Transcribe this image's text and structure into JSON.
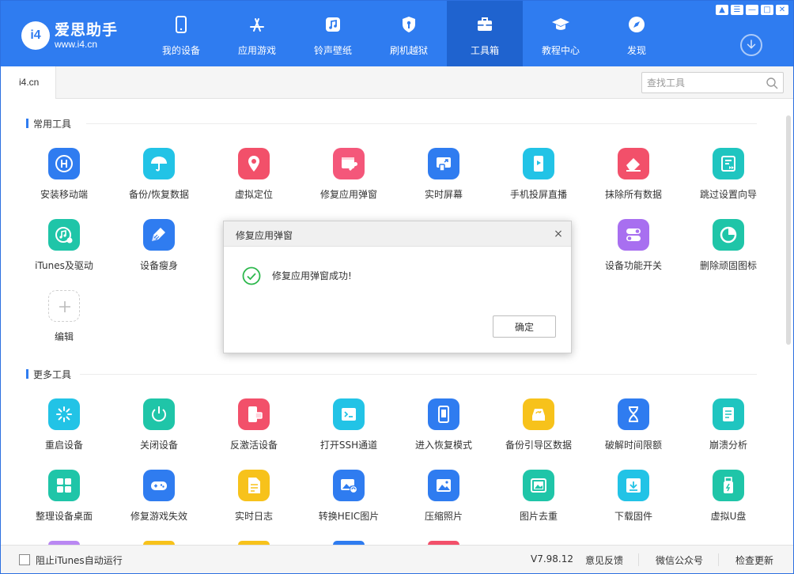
{
  "app": {
    "name": "爱思助手",
    "url": "www.i4.cn",
    "logo_mark": "i4"
  },
  "colors": {
    "header": "#2f7cf0",
    "header_active": "#1f63cf",
    "accent": "#2f7cf0"
  },
  "nav": [
    {
      "label": "我的设备",
      "icon": "phone-icon"
    },
    {
      "label": "应用游戏",
      "icon": "app-store-icon"
    },
    {
      "label": "铃声壁纸",
      "icon": "music-icon"
    },
    {
      "label": "刷机越狱",
      "icon": "shield-key-icon"
    },
    {
      "label": "工具箱",
      "icon": "toolbox-icon",
      "active": true
    },
    {
      "label": "教程中心",
      "icon": "graduation-cap-icon"
    },
    {
      "label": "发现",
      "icon": "compass-icon"
    }
  ],
  "window_controls": [
    "shirt-icon",
    "menu-icon",
    "minimize-icon",
    "maximize-icon",
    "close-icon"
  ],
  "tab": {
    "label": "i4.cn"
  },
  "search": {
    "placeholder": "查找工具",
    "value": ""
  },
  "sections": {
    "common": "常用工具",
    "more": "更多工具"
  },
  "common_tools": [
    {
      "label": "安装移动端",
      "color": "#2f7cf0",
      "icon": "i4-app-icon"
    },
    {
      "label": "备份/恢复数据",
      "color": "#22c3e6",
      "icon": "umbrella-icon"
    },
    {
      "label": "虚拟定位",
      "color": "#f2506a",
      "icon": "location-pin-icon"
    },
    {
      "label": "修复应用弹窗",
      "color": "#f4577a",
      "icon": "repair-window-icon"
    },
    {
      "label": "实时屏幕",
      "color": "#2f7cf0",
      "icon": "screen-share-icon"
    },
    {
      "label": "手机投屏直播",
      "color": "#22c3e6",
      "icon": "phone-play-icon"
    },
    {
      "label": "抹除所有数据",
      "color": "#f2506a",
      "icon": "eraser-icon"
    },
    {
      "label": "跳过设置向导",
      "color": "#1fc5c0",
      "icon": "skip-setup-icon"
    },
    {
      "label": "iTunes及驱动",
      "color": "#1fc5a8",
      "icon": "itunes-icon"
    },
    {
      "label": "设备瘦身",
      "color": "#2f7cf0",
      "icon": "broom-icon"
    },
    {
      "label": "设备功能开关",
      "color": "#a86ff0",
      "icon": "toggle-icon"
    },
    {
      "label": "删除顽固图标",
      "color": "#1fc5a8",
      "icon": "pie-icon"
    },
    {
      "label": "编辑",
      "color": "#ffffff",
      "icon": "plus-icon"
    }
  ],
  "more_tools": [
    {
      "label": "重启设备",
      "color": "#22c3e6",
      "icon": "restart-icon"
    },
    {
      "label": "关闭设备",
      "color": "#1fc5a8",
      "icon": "power-icon"
    },
    {
      "label": "反激活设备",
      "color": "#f2506a",
      "icon": "deactivate-icon"
    },
    {
      "label": "打开SSH通道",
      "color": "#22c3e6",
      "icon": "terminal-icon"
    },
    {
      "label": "进入恢复模式",
      "color": "#2f7cf0",
      "icon": "recovery-icon"
    },
    {
      "label": "备份引导区数据",
      "color": "#f7c21b",
      "icon": "disk-backup-icon"
    },
    {
      "label": "破解时间限额",
      "color": "#2f7cf0",
      "icon": "hourglass-icon"
    },
    {
      "label": "崩溃分析",
      "color": "#1fc5c0",
      "icon": "report-icon"
    },
    {
      "label": "整理设备桌面",
      "color": "#1fc5a8",
      "icon": "grid-icon"
    },
    {
      "label": "修复游戏失效",
      "color": "#2f7cf0",
      "icon": "gamepad-icon"
    },
    {
      "label": "实时日志",
      "color": "#f7c21b",
      "icon": "log-icon"
    },
    {
      "label": "转换HEIC图片",
      "color": "#2f7cf0",
      "icon": "image-convert-icon"
    },
    {
      "label": "压缩照片",
      "color": "#2f7cf0",
      "icon": "image-icon"
    },
    {
      "label": "图片去重",
      "color": "#1fc5a8",
      "icon": "image-dedupe-icon"
    },
    {
      "label": "下载固件",
      "color": "#22c3e6",
      "icon": "download-box-icon"
    },
    {
      "label": "虚拟U盘",
      "color": "#1fc5a8",
      "icon": "usb-drive-icon"
    }
  ],
  "status": {
    "checkbox_label": "阻止iTunes自动运行",
    "checked": false,
    "version": "V7.98.12",
    "feedback": "意见反馈",
    "wechat": "微信公众号",
    "update": "检查更新"
  },
  "dialog": {
    "title": "修复应用弹窗",
    "message": "修复应用弹窗成功!",
    "ok": "确定",
    "close": "×"
  }
}
